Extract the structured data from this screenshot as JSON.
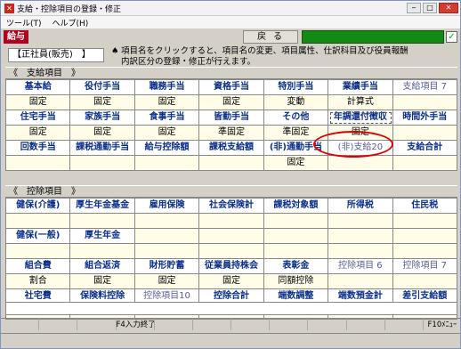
{
  "window": {
    "title": "支給・控除項目の登録・修正",
    "app_icon": "✕",
    "buttons": [
      "minimize-icon",
      "maximize-icon",
      "close-icon"
    ],
    "button_glyphs": [
      "‒",
      "□",
      "✕"
    ]
  },
  "menu": [
    "ツール(T)",
    "ヘルプ(H)"
  ],
  "toolbar": {
    "tab_label": "給与",
    "back_label": "戻る",
    "progress_color": "#148a14",
    "check_glyph": "✓"
  },
  "employee_type": "【正社員(販売)　】",
  "info_text": {
    "symbol": "♠",
    "line1": "項目名をクリックすると、項目名の変更、項目属性、仕訳科目及び役員報酬",
    "line2": "内訳区分の登録・修正が行えます。"
  },
  "payments": {
    "title": "《　支給項目　》",
    "rows": [
      [
        {
          "name": "基本給",
          "value": "固定"
        },
        {
          "name": "役付手当",
          "value": "固定"
        },
        {
          "name": "職務手当",
          "value": "固定"
        },
        {
          "name": "資格手当",
          "value": "固定"
        },
        {
          "name": "特別手当",
          "value": "変動"
        },
        {
          "name": "業績手当",
          "value": "計算式"
        },
        {
          "name": "支給項目 7",
          "value": "",
          "muted": true
        }
      ],
      [
        {
          "name": "住宅手当",
          "value": "固定"
        },
        {
          "name": "家族手当",
          "value": "固定"
        },
        {
          "name": "食事手当",
          "value": "固定"
        },
        {
          "name": "皆勤手当",
          "value": "準固定"
        },
        {
          "name": "その他",
          "value": "準固定"
        },
        {
          "name": "年調還付徴収",
          "value": "固定",
          "highlight": true
        },
        {
          "name": "時間外手当",
          "value": ""
        }
      ],
      [
        {
          "name": "回数手当",
          "value": ""
        },
        {
          "name": "課税通勤手当",
          "value": ""
        },
        {
          "name": "給与控除額",
          "value": ""
        },
        {
          "name": "課税支給額",
          "value": ""
        },
        {
          "name": "(非)通勤手当",
          "value": "固定"
        },
        {
          "name": "(非)支給20",
          "value": "",
          "muted": true
        },
        {
          "name": "支給合計",
          "value": ""
        }
      ]
    ]
  },
  "deductions": {
    "title": "《　控除項目　》",
    "rows": [
      [
        {
          "name": "健保(介護)",
          "value": ""
        },
        {
          "name": "厚生年金基金",
          "value": ""
        },
        {
          "name": "雇用保険",
          "value": ""
        },
        {
          "name": "社会保険計",
          "value": ""
        },
        {
          "name": "課税対象額",
          "value": ""
        },
        {
          "name": "所得税",
          "value": ""
        },
        {
          "name": "住民税",
          "value": ""
        }
      ],
      [
        {
          "name": "健保(一般)",
          "value": ""
        },
        {
          "name": "厚生年金",
          "value": ""
        }
      ],
      [
        {
          "name": "組合費",
          "value": "割合"
        },
        {
          "name": "組合返済",
          "value": "固定"
        },
        {
          "name": "財形貯蓄",
          "value": "固定"
        },
        {
          "name": "従業員持株会",
          "value": "固定"
        },
        {
          "name": "表彰金",
          "value": "同額控除"
        },
        {
          "name": "控除項目 6",
          "value": "",
          "muted": true
        },
        {
          "name": "控除項目 7",
          "value": "",
          "muted": true
        }
      ],
      [
        {
          "name": "社宅費",
          "value": "固定"
        },
        {
          "name": "保険料控除",
          "value": "固定"
        },
        {
          "name": "控除項目10",
          "value": "",
          "muted": true
        },
        {
          "name": "控除合計",
          "value": ""
        },
        {
          "name": "端数調整",
          "value": ""
        },
        {
          "name": "端数預金計",
          "value": ""
        },
        {
          "name": "差引支給額",
          "value": ""
        }
      ]
    ]
  },
  "function_keys": [
    "",
    "",
    "",
    "F4入力終了",
    "",
    "",
    "",
    "",
    "",
    "",
    "",
    "F10ﾒﾆｭｰ"
  ],
  "colors": {
    "header_text": "#0a2e8a",
    "value_bg": "#fffde8",
    "highlight_ring": "#e00000",
    "tab_bg": "#b3001b"
  }
}
